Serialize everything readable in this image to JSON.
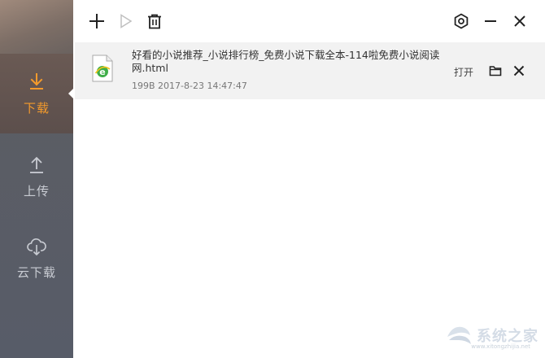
{
  "sidebar": {
    "items": [
      {
        "label": "下载",
        "icon": "download-icon",
        "active": true
      },
      {
        "label": "上传",
        "icon": "upload-icon",
        "active": false
      },
      {
        "label": "云下载",
        "icon": "cloud-download-icon",
        "active": false
      }
    ]
  },
  "toolbar": {
    "icons": [
      "add-icon",
      "play-icon",
      "delete-icon",
      "settings-icon",
      "minimize-icon",
      "close-icon"
    ]
  },
  "downloads": [
    {
      "name": "好看的小说推荐_小说排行榜_免费小说下载全本-114啦免费小说阅读网.html",
      "size": "199B",
      "time": "2017-8-23 14:47:47",
      "open_label": "打开",
      "icon": "ie-html-file-icon"
    }
  ],
  "watermark": {
    "text": "系统之家",
    "sub": "www.xitongzhijia.net"
  },
  "colors": {
    "accent": "#f39a2c",
    "sidebar": "#575c68",
    "row_bg": "#f2f2f2"
  }
}
